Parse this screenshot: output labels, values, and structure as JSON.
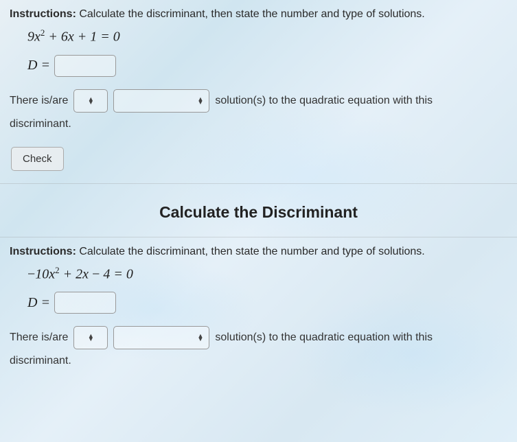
{
  "problem1": {
    "instructions_label": "Instructions:",
    "instructions_text": " Calculate the discriminant, then state the number and type of solutions.",
    "equation_html": "9x² + 6x + 1 = 0",
    "d_label": "D =",
    "d_value": "",
    "sentence_before": "There is/are",
    "sentence_after": "solution(s) to the quadratic equation with this",
    "sentence_end": "discriminant.",
    "check_label": "Check"
  },
  "section_heading": "Calculate the Discriminant",
  "problem2": {
    "instructions_label": "Instructions:",
    "instructions_text": " Calculate the discriminant, then state the number and type of solutions.",
    "equation_html": "−10x² + 2x − 4 = 0",
    "d_label": "D =",
    "d_value": "",
    "sentence_before": "There is/are",
    "sentence_after": "solution(s) to the quadratic equation with this",
    "sentence_end": "discriminant."
  }
}
